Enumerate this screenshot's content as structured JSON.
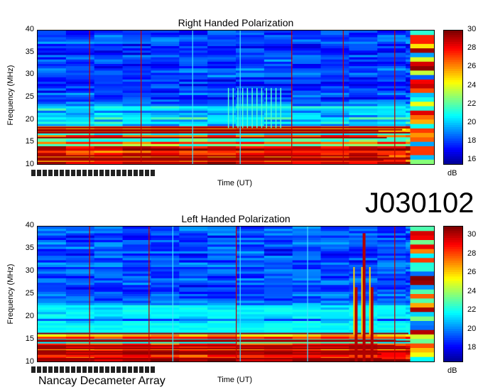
{
  "observatory": "Nancay Decameter Array",
  "observation_id": "J030102",
  "chart_data": [
    {
      "type": "heatmap",
      "title": "Right Handed Polarization",
      "xlabel": "Time (UT)",
      "ylabel": "Frequency (MHz)",
      "ylim": [
        10,
        40
      ],
      "yticks": [
        10,
        15,
        20,
        25,
        30,
        35,
        40
      ],
      "colorbar": {
        "label": "dB",
        "range": [
          15.5,
          30
        ],
        "ticks": [
          16,
          18,
          20,
          22,
          24,
          26,
          28,
          30
        ]
      }
    },
    {
      "type": "heatmap",
      "title": "Left Handed Polarization",
      "xlabel": "Time (UT)",
      "ylabel": "Frequency (MHz)",
      "ylim": [
        10,
        40
      ],
      "yticks": [
        10,
        15,
        20,
        25,
        30,
        35,
        40
      ],
      "colorbar": {
        "label": "dB",
        "range": [
          16.5,
          31
        ],
        "ticks": [
          18,
          20,
          22,
          24,
          26,
          28,
          30
        ]
      }
    }
  ],
  "colors": {
    "background_low": "#0a2fd8",
    "high": "#a00000",
    "marker_line": "#c00000"
  }
}
